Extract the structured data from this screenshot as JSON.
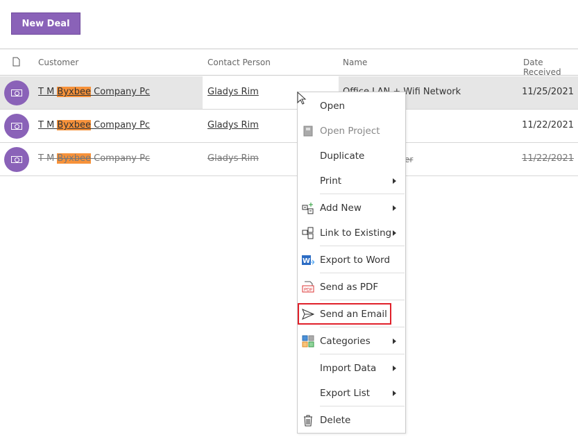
{
  "toolbar": {
    "new_deal_label": "New Deal"
  },
  "columns": {
    "customer": "Customer",
    "contact": "Contact Person",
    "name": "Name",
    "date": "Date Received"
  },
  "rows": [
    {
      "customer_pre": "T M ",
      "customer_hl": "Byxbee",
      "customer_post": " Company Pc",
      "contact": "Gladys Rim",
      "name": "Office LAN + Wifi Network",
      "date": "11/25/2021",
      "strike": false
    },
    {
      "customer_pre": "T M ",
      "customer_hl": "Byxbee",
      "customer_post": " Company Pc",
      "contact": "Gladys Rim",
      "name": "",
      "date": "11/22/2021",
      "strike": false
    },
    {
      "customer_pre": "T M ",
      "customer_hl": "Byxbee",
      "customer_post": " Company Pc",
      "contact": "Gladys Rim",
      "name": "er",
      "date": "11/22/2021",
      "strike": true
    }
  ],
  "menu": {
    "items": [
      {
        "label": "Open"
      },
      {
        "label": "Open Project",
        "disabled": true
      },
      {
        "label": "Duplicate"
      },
      {
        "label": "Print",
        "submenu": true
      },
      {
        "label": "Add New",
        "submenu": true
      },
      {
        "label": "Link to Existing",
        "submenu": true
      },
      {
        "label": "Export to Word"
      },
      {
        "label": "Send as PDF"
      },
      {
        "label": "Send an Email",
        "highlighted": true
      },
      {
        "label": "Categories",
        "submenu": true
      },
      {
        "label": "Import Data",
        "submenu": true
      },
      {
        "label": "Export List",
        "submenu": true
      },
      {
        "label": "Delete"
      }
    ]
  },
  "colors": {
    "accent": "#8a62b8",
    "highlight": "#f7923a",
    "selected_row": "#e6e6e6",
    "focus_box": "#e0202a"
  }
}
